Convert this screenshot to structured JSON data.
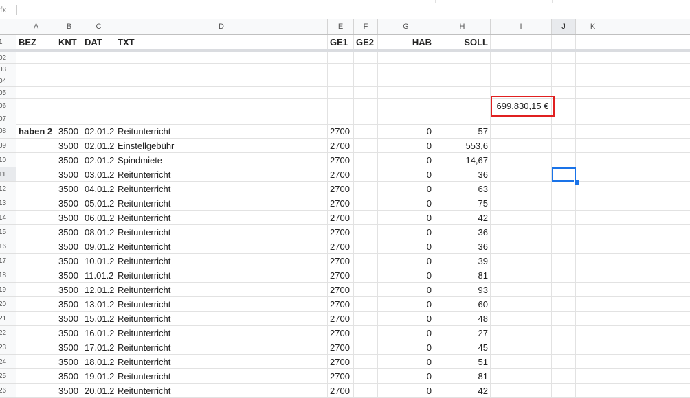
{
  "formula_bar": {
    "icon": "fx",
    "value": ""
  },
  "columns": [
    {
      "letter": "A"
    },
    {
      "letter": "B"
    },
    {
      "letter": "C"
    },
    {
      "letter": "D"
    },
    {
      "letter": "E"
    },
    {
      "letter": "F"
    },
    {
      "letter": "G"
    },
    {
      "letter": "H"
    },
    {
      "letter": "I"
    },
    {
      "letter": "J"
    },
    {
      "letter": "K"
    }
  ],
  "selected_column": "J",
  "header_row": {
    "num": "1",
    "cells": [
      "BEZ",
      "KNT",
      "DAT",
      "TXT",
      "GE1",
      "GE2",
      "HAB",
      "SOLL",
      "",
      "",
      ""
    ]
  },
  "empty_rows": [
    "02",
    "03",
    "04",
    "05",
    "06",
    "07"
  ],
  "total_cell": {
    "row": "06",
    "column": "I",
    "value": "699.830,15 €"
  },
  "data_rows": [
    {
      "num": "08",
      "cells": [
        "haben 2",
        "3500",
        "02.01.2",
        "Reitunterricht",
        "2700",
        "",
        "0",
        "57"
      ]
    },
    {
      "num": "09",
      "cells": [
        "",
        "3500",
        "02.01.2",
        "Einstellgebühr",
        "2700",
        "",
        "0",
        "553,6"
      ]
    },
    {
      "num": "10",
      "cells": [
        "",
        "3500",
        "02.01.2",
        "Spindmiete",
        "2700",
        "",
        "0",
        "14,67"
      ]
    },
    {
      "num": "11",
      "cells": [
        "",
        "3500",
        "03.01.2",
        "Reitunterricht",
        "2700",
        "",
        "0",
        "36"
      ]
    },
    {
      "num": "12",
      "cells": [
        "",
        "3500",
        "04.01.2",
        "Reitunterricht",
        "2700",
        "",
        "0",
        "63"
      ]
    },
    {
      "num": "13",
      "cells": [
        "",
        "3500",
        "05.01.2",
        "Reitunterricht",
        "2700",
        "",
        "0",
        "75"
      ]
    },
    {
      "num": "14",
      "cells": [
        "",
        "3500",
        "06.01.2",
        "Reitunterricht",
        "2700",
        "",
        "0",
        "42"
      ]
    },
    {
      "num": "15",
      "cells": [
        "",
        "3500",
        "08.01.2",
        "Reitunterricht",
        "2700",
        "",
        "0",
        "36"
      ]
    },
    {
      "num": "16",
      "cells": [
        "",
        "3500",
        "09.01.2",
        "Reitunterricht",
        "2700",
        "",
        "0",
        "36"
      ]
    },
    {
      "num": "17",
      "cells": [
        "",
        "3500",
        "10.01.2",
        "Reitunterricht",
        "2700",
        "",
        "0",
        "39"
      ]
    },
    {
      "num": "18",
      "cells": [
        "",
        "3500",
        "11.01.2",
        "Reitunterricht",
        "2700",
        "",
        "0",
        "81"
      ]
    },
    {
      "num": "19",
      "cells": [
        "",
        "3500",
        "12.01.2",
        "Reitunterricht",
        "2700",
        "",
        "0",
        "93"
      ]
    },
    {
      "num": "20",
      "cells": [
        "",
        "3500",
        "13.01.2",
        "Reitunterricht",
        "2700",
        "",
        "0",
        "60"
      ]
    },
    {
      "num": "21",
      "cells": [
        "",
        "3500",
        "15.01.2",
        "Reitunterricht",
        "2700",
        "",
        "0",
        "48"
      ]
    },
    {
      "num": "22",
      "cells": [
        "",
        "3500",
        "16.01.2",
        "Reitunterricht",
        "2700",
        "",
        "0",
        "27"
      ]
    },
    {
      "num": "23",
      "cells": [
        "",
        "3500",
        "17.01.2",
        "Reitunterricht",
        "2700",
        "",
        "0",
        "45"
      ]
    },
    {
      "num": "24",
      "cells": [
        "",
        "3500",
        "18.01.2",
        "Reitunterricht",
        "2700",
        "",
        "0",
        "51"
      ]
    },
    {
      "num": "25",
      "cells": [
        "",
        "3500",
        "19.01.2",
        "Reitunterricht",
        "2700",
        "",
        "0",
        "81"
      ]
    },
    {
      "num": "26",
      "cells": [
        "",
        "3500",
        "20.01.2",
        "Reitunterricht",
        "2700",
        "",
        "0",
        "42"
      ]
    }
  ],
  "selected_cell": {
    "row": "11",
    "column": "J"
  }
}
